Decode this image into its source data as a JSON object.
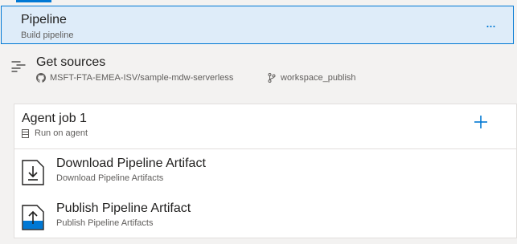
{
  "pipeline": {
    "title": "Pipeline",
    "subtitle": "Build pipeline",
    "more_label": "..."
  },
  "sources": {
    "title": "Get sources",
    "repository": "MSFT-FTA-EMEA-ISV/sample-mdw-serverless",
    "branch": "workspace_publish"
  },
  "agent_job": {
    "title": "Agent job 1",
    "subtitle": "Run on agent",
    "add_icon": "plus-icon"
  },
  "tasks": [
    {
      "title": "Download Pipeline Artifact",
      "subtitle": "Download Pipeline Artifacts",
      "icon": "download-artifact-icon"
    },
    {
      "title": "Publish Pipeline Artifact",
      "subtitle": "Publish Pipeline Artifacts",
      "icon": "publish-artifact-icon"
    }
  ],
  "colors": {
    "accent": "#0078d4",
    "selected_bg": "#deecf9",
    "panel_bg": "#f3f2f1"
  }
}
